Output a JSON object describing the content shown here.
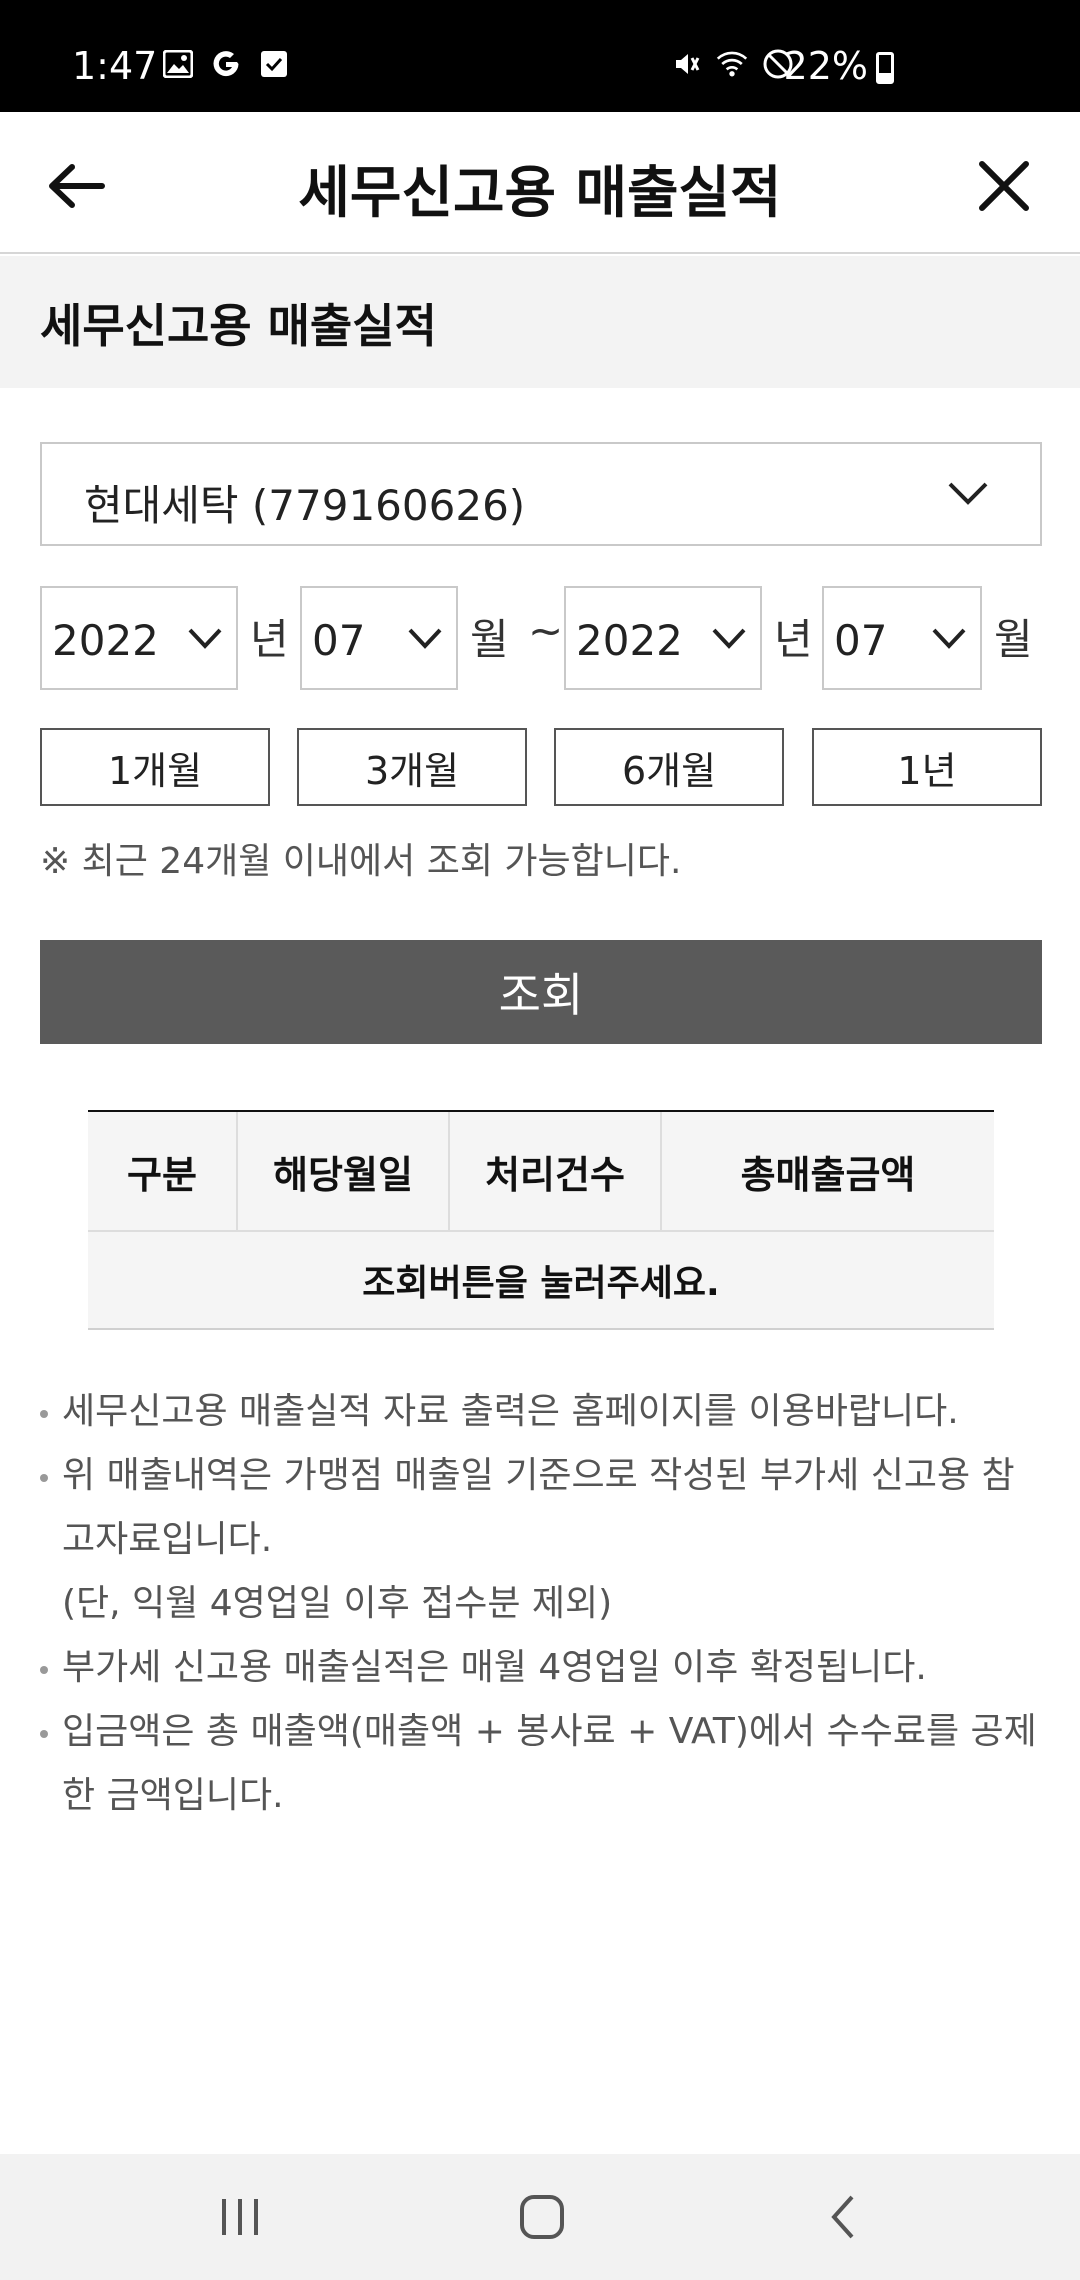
{
  "status_bar": {
    "time": "1:47",
    "battery": "22%",
    "left_icons": [
      "image-icon",
      "google-icon",
      "checkbox-icon"
    ],
    "right_icons": [
      "mute-icon",
      "wifi-icon",
      "block-icon"
    ]
  },
  "header": {
    "title": "세무신고용 매출실적"
  },
  "section": {
    "title": "세무신고용 매출실적"
  },
  "store_select": {
    "value": "현대세탁 (779160626)"
  },
  "date_range": {
    "start_year": "2022",
    "start_month": "07",
    "end_year": "2022",
    "end_month": "07",
    "year_label": "년",
    "month_label": "월",
    "separator": "~"
  },
  "period_buttons": [
    "1개월",
    "3개월",
    "6개월",
    "1년"
  ],
  "notice": "※ 최근 24개월 이내에서 조회 가능합니다.",
  "search_button": "조회",
  "table": {
    "headers": [
      "구분",
      "해당월일",
      "처리건수",
      "총매출금액"
    ],
    "empty_message": "조회버튼을 눌러주세요."
  },
  "notes": [
    "세무신고용 매출실적 자료 출력은 홈페이지를 이용바랍니다.",
    "위 매출내역은 가맹점 매출일 기준으로 작성된 부가세 신고용 참고자료입니다.",
    "(단, 익월 4영업일 이후 접수분 제외)",
    "부가세 신고용 매출실적은 매월 4영업일 이후 확정됩니다.",
    "입금액은 총 매출액(매출액 + 봉사료 + VAT)에서 수수료를 공제한 금액입니다."
  ],
  "colors": {
    "search_button_bg": "#5a5a5a",
    "section_band_bg": "#f3f3f3",
    "table_header_bg": "#f5f5f5"
  }
}
